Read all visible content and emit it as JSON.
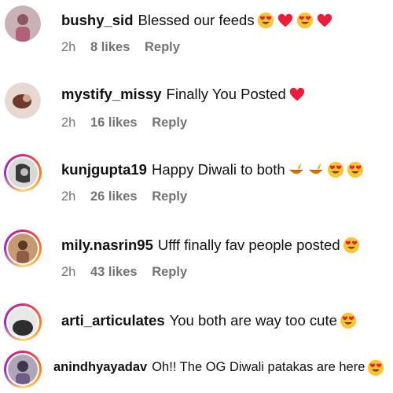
{
  "comments": [
    {
      "username": "bushy_sid",
      "text": "Blessed our feeds",
      "emojis": [
        "heart-eyes",
        "red-heart",
        "heart-eyes",
        "red-heart"
      ],
      "time": "2h",
      "likes": "8 likes",
      "reply": "Reply",
      "ring": false,
      "avatar_colors": [
        "#c8b2b5",
        "#8a5a64"
      ]
    },
    {
      "username": "mystify_missy",
      "text": "Finally You Posted",
      "emojis": [
        "red-heart"
      ],
      "time": "2h",
      "likes": "16 likes",
      "reply": "Reply",
      "ring": false,
      "avatar_colors": [
        "#e8d8d2",
        "#6b3b2b"
      ]
    },
    {
      "username": "kunjgupta19",
      "text": "Happy Diwali to both",
      "emojis": [
        "diya-lamp",
        "diya-lamp",
        "heart-eyes",
        "heart-eyes"
      ],
      "time": "2h",
      "likes": "26 likes",
      "reply": "Reply",
      "ring": true,
      "avatar_colors": [
        "#d9d9d9",
        "#3a3a3a"
      ]
    },
    {
      "username": "mily.nasrin95",
      "text": "Ufff finally fav people posted",
      "emojis": [
        "heart-eyes"
      ],
      "time": "2h",
      "likes": "43 likes",
      "reply": "Reply",
      "ring": true,
      "avatar_colors": [
        "#c79a74",
        "#5a3b2a"
      ]
    },
    {
      "username": "arti_articulates",
      "text": "You both are way too cute",
      "emojis": [
        "heart-eyes"
      ],
      "ring": true,
      "avatar_colors": [
        "#e8e8e8",
        "#2e2e2e"
      ]
    },
    {
      "username": "anindhyayadav",
      "text": "Oh!! The OG Diwali patakas are here",
      "emojis": [
        "heart-eyes"
      ],
      "ring": true,
      "avatar_colors": [
        "#b0a6b8",
        "#3e3550"
      ]
    }
  ],
  "colors": {
    "meta": "#737373",
    "heart": "#ed1c3a",
    "emoji_face": "#f7c531"
  }
}
